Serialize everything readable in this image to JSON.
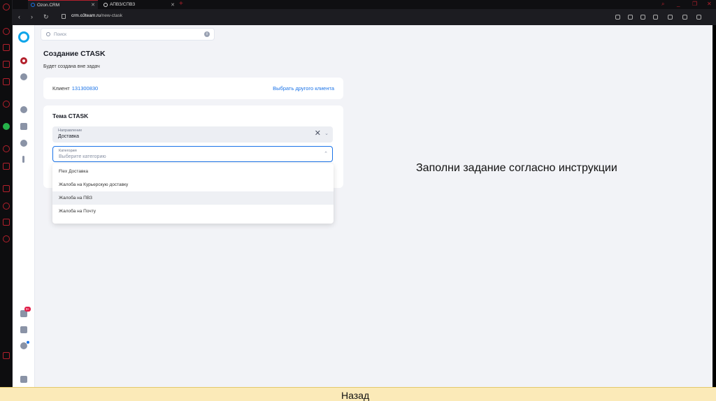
{
  "browser": {
    "tabs": [
      {
        "label": "Ozon.CRM"
      },
      {
        "label": "АПВЗ/СПВЗ"
      }
    ],
    "new_tab": "+",
    "url_host": "crm.o3team.ru",
    "url_path": "/new-ctask"
  },
  "search": {
    "placeholder": "Поиск",
    "info": "i"
  },
  "rail": {
    "badge": "9+"
  },
  "page": {
    "title": "Создание CTASK",
    "subtitle": "Будет создана вне задач"
  },
  "client": {
    "label": "Клиент",
    "id": "131300830",
    "change": "Выбрать другого клиента"
  },
  "topic": {
    "title": "Тема CTASK",
    "direction": {
      "label": "Направление",
      "value": "Доставка"
    },
    "category": {
      "label": "Категория",
      "placeholder": "Выберите категорию"
    },
    "options": [
      "Flex Доставка",
      "Жалоба на Курьерскую доставку",
      "Жалоба на ПВЗ",
      "Жалоба на Почту"
    ]
  },
  "instruction": "Заполни задание согласно инструкции",
  "footer": {
    "back": "Назад"
  },
  "colors": {
    "accent": "#1a73e8",
    "brand": "#0ea5e9",
    "opera_red": "#b3202c",
    "footer_bg": "#fbeab8"
  }
}
